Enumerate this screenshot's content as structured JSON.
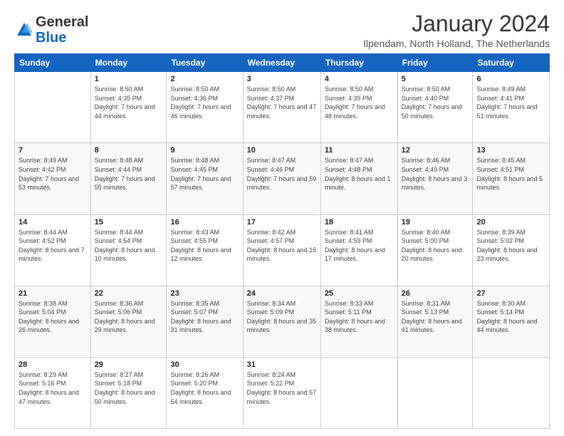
{
  "logo": {
    "general": "General",
    "blue": "Blue"
  },
  "header": {
    "title": "January 2024",
    "location": "Ilpendam, North Holland, The Netherlands"
  },
  "columns": [
    "Sunday",
    "Monday",
    "Tuesday",
    "Wednesday",
    "Thursday",
    "Friday",
    "Saturday"
  ],
  "weeks": [
    [
      {
        "day": "",
        "sunrise": "",
        "sunset": "",
        "daylight": ""
      },
      {
        "day": "1",
        "sunrise": "Sunrise: 8:50 AM",
        "sunset": "Sunset: 4:35 PM",
        "daylight": "Daylight: 7 hours and 44 minutes."
      },
      {
        "day": "2",
        "sunrise": "Sunrise: 8:50 AM",
        "sunset": "Sunset: 4:36 PM",
        "daylight": "Daylight: 7 hours and 46 minutes."
      },
      {
        "day": "3",
        "sunrise": "Sunrise: 8:50 AM",
        "sunset": "Sunset: 4:37 PM",
        "daylight": "Daylight: 7 hours and 47 minutes."
      },
      {
        "day": "4",
        "sunrise": "Sunrise: 8:50 AM",
        "sunset": "Sunset: 4:39 PM",
        "daylight": "Daylight: 7 hours and 48 minutes."
      },
      {
        "day": "5",
        "sunrise": "Sunrise: 8:50 AM",
        "sunset": "Sunset: 4:40 PM",
        "daylight": "Daylight: 7 hours and 50 minutes."
      },
      {
        "day": "6",
        "sunrise": "Sunrise: 8:49 AM",
        "sunset": "Sunset: 4:41 PM",
        "daylight": "Daylight: 7 hours and 51 minutes."
      }
    ],
    [
      {
        "day": "7",
        "sunrise": "Sunrise: 8:49 AM",
        "sunset": "Sunset: 4:42 PM",
        "daylight": "Daylight: 7 hours and 53 minutes."
      },
      {
        "day": "8",
        "sunrise": "Sunrise: 8:48 AM",
        "sunset": "Sunset: 4:44 PM",
        "daylight": "Daylight: 7 hours and 55 minutes."
      },
      {
        "day": "9",
        "sunrise": "Sunrise: 8:48 AM",
        "sunset": "Sunset: 4:45 PM",
        "daylight": "Daylight: 7 hours and 57 minutes."
      },
      {
        "day": "10",
        "sunrise": "Sunrise: 8:47 AM",
        "sunset": "Sunset: 4:46 PM",
        "daylight": "Daylight: 7 hours and 59 minutes."
      },
      {
        "day": "11",
        "sunrise": "Sunrise: 8:47 AM",
        "sunset": "Sunset: 4:48 PM",
        "daylight": "Daylight: 8 hours and 1 minute."
      },
      {
        "day": "12",
        "sunrise": "Sunrise: 8:46 AM",
        "sunset": "Sunset: 4:49 PM",
        "daylight": "Daylight: 8 hours and 3 minutes."
      },
      {
        "day": "13",
        "sunrise": "Sunrise: 8:45 AM",
        "sunset": "Sunset: 4:51 PM",
        "daylight": "Daylight: 8 hours and 5 minutes."
      }
    ],
    [
      {
        "day": "14",
        "sunrise": "Sunrise: 8:44 AM",
        "sunset": "Sunset: 4:52 PM",
        "daylight": "Daylight: 8 hours and 7 minutes."
      },
      {
        "day": "15",
        "sunrise": "Sunrise: 8:44 AM",
        "sunset": "Sunset: 4:54 PM",
        "daylight": "Daylight: 8 hours and 10 minutes."
      },
      {
        "day": "16",
        "sunrise": "Sunrise: 8:43 AM",
        "sunset": "Sunset: 4:55 PM",
        "daylight": "Daylight: 8 hours and 12 minutes."
      },
      {
        "day": "17",
        "sunrise": "Sunrise: 8:42 AM",
        "sunset": "Sunset: 4:57 PM",
        "daylight": "Daylight: 8 hours and 15 minutes."
      },
      {
        "day": "18",
        "sunrise": "Sunrise: 8:41 AM",
        "sunset": "Sunset: 4:59 PM",
        "daylight": "Daylight: 8 hours and 17 minutes."
      },
      {
        "day": "19",
        "sunrise": "Sunrise: 8:40 AM",
        "sunset": "Sunset: 5:00 PM",
        "daylight": "Daylight: 8 hours and 20 minutes."
      },
      {
        "day": "20",
        "sunrise": "Sunrise: 8:39 AM",
        "sunset": "Sunset: 5:02 PM",
        "daylight": "Daylight: 8 hours and 23 minutes."
      }
    ],
    [
      {
        "day": "21",
        "sunrise": "Sunrise: 8:38 AM",
        "sunset": "Sunset: 5:04 PM",
        "daylight": "Daylight: 8 hours and 26 minutes."
      },
      {
        "day": "22",
        "sunrise": "Sunrise: 8:36 AM",
        "sunset": "Sunset: 5:06 PM",
        "daylight": "Daylight: 8 hours and 29 minutes."
      },
      {
        "day": "23",
        "sunrise": "Sunrise: 8:35 AM",
        "sunset": "Sunset: 5:07 PM",
        "daylight": "Daylight: 8 hours and 31 minutes."
      },
      {
        "day": "24",
        "sunrise": "Sunrise: 8:34 AM",
        "sunset": "Sunset: 5:09 PM",
        "daylight": "Daylight: 8 hours and 35 minutes."
      },
      {
        "day": "25",
        "sunrise": "Sunrise: 8:33 AM",
        "sunset": "Sunset: 5:11 PM",
        "daylight": "Daylight: 8 hours and 38 minutes."
      },
      {
        "day": "26",
        "sunrise": "Sunrise: 8:31 AM",
        "sunset": "Sunset: 5:13 PM",
        "daylight": "Daylight: 8 hours and 41 minutes."
      },
      {
        "day": "27",
        "sunrise": "Sunrise: 8:30 AM",
        "sunset": "Sunset: 5:14 PM",
        "daylight": "Daylight: 8 hours and 44 minutes."
      }
    ],
    [
      {
        "day": "28",
        "sunrise": "Sunrise: 8:29 AM",
        "sunset": "Sunset: 5:16 PM",
        "daylight": "Daylight: 8 hours and 47 minutes."
      },
      {
        "day": "29",
        "sunrise": "Sunrise: 8:27 AM",
        "sunset": "Sunset: 5:18 PM",
        "daylight": "Daylight: 8 hours and 50 minutes."
      },
      {
        "day": "30",
        "sunrise": "Sunrise: 8:26 AM",
        "sunset": "Sunset: 5:20 PM",
        "daylight": "Daylight: 8 hours and 54 minutes."
      },
      {
        "day": "31",
        "sunrise": "Sunrise: 8:24 AM",
        "sunset": "Sunset: 5:22 PM",
        "daylight": "Daylight: 8 hours and 57 minutes."
      },
      {
        "day": "",
        "sunrise": "",
        "sunset": "",
        "daylight": ""
      },
      {
        "day": "",
        "sunrise": "",
        "sunset": "",
        "daylight": ""
      },
      {
        "day": "",
        "sunrise": "",
        "sunset": "",
        "daylight": ""
      }
    ]
  ]
}
